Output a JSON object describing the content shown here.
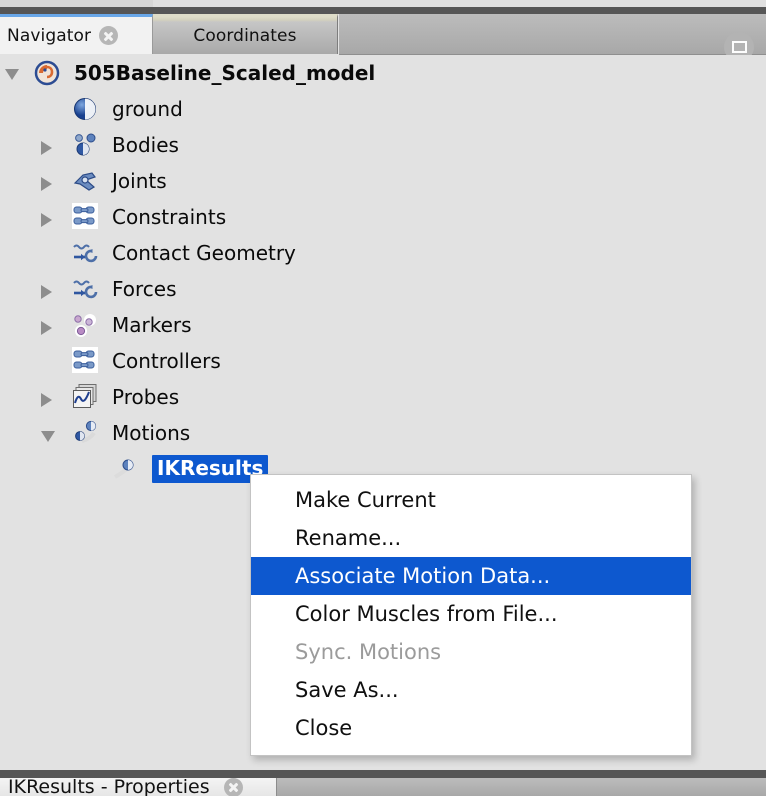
{
  "window": {
    "maximize_button": "restore-window-button"
  },
  "tabs": {
    "active": "Navigator",
    "items": [
      {
        "label": "Navigator",
        "active": true,
        "closable": true
      },
      {
        "label": "Coordinates",
        "active": false,
        "closable": false
      }
    ]
  },
  "tree": {
    "nodes": [
      {
        "label": "505Baseline_Scaled_model",
        "icon": "opensim-model-icon",
        "depth": 0,
        "expander": "open",
        "selected": false,
        "bold": true
      },
      {
        "label": "ground",
        "icon": "ground-body-icon",
        "depth": 1,
        "expander": "none",
        "selected": false,
        "bold": false
      },
      {
        "label": "Bodies",
        "icon": "bodies-icon",
        "depth": 1,
        "expander": "closed",
        "selected": false,
        "bold": false
      },
      {
        "label": "Joints",
        "icon": "joints-icon",
        "depth": 1,
        "expander": "closed",
        "selected": false,
        "bold": false
      },
      {
        "label": "Constraints",
        "icon": "constraints-chain-icon",
        "depth": 1,
        "expander": "closed",
        "selected": false,
        "bold": false
      },
      {
        "label": "Contact Geometry",
        "icon": "contact-geometry-icon",
        "depth": 1,
        "expander": "none",
        "selected": false,
        "bold": false
      },
      {
        "label": "Forces",
        "icon": "forces-icon",
        "depth": 1,
        "expander": "closed",
        "selected": false,
        "bold": false
      },
      {
        "label": "Markers",
        "icon": "markers-icon",
        "depth": 1,
        "expander": "closed",
        "selected": false,
        "bold": false
      },
      {
        "label": "Controllers",
        "icon": "controllers-chain-icon",
        "depth": 1,
        "expander": "none",
        "selected": false,
        "bold": false
      },
      {
        "label": "Probes",
        "icon": "probes-icon",
        "depth": 1,
        "expander": "closed",
        "selected": false,
        "bold": false
      },
      {
        "label": "Motions",
        "icon": "motions-icon",
        "depth": 1,
        "expander": "open",
        "selected": false,
        "bold": false
      },
      {
        "label": "IKResults",
        "icon": "motion-item-icon",
        "depth": 2,
        "expander": "none",
        "selected": true,
        "bold": true
      }
    ]
  },
  "context_menu": {
    "items": [
      {
        "label": "Make Current",
        "state": "normal"
      },
      {
        "label": "Rename...",
        "state": "normal"
      },
      {
        "label": "Associate Motion Data...",
        "state": "selected"
      },
      {
        "label": "Color Muscles from File...",
        "state": "normal"
      },
      {
        "label": "Sync. Motions",
        "state": "disabled"
      },
      {
        "label": "Save As...",
        "state": "normal"
      },
      {
        "label": "Close",
        "state": "normal"
      }
    ]
  },
  "bottom_bar": {
    "tab_label": "IKResults - Properties"
  },
  "colors": {
    "selection_blue": "#0d58cf",
    "panel_background": "#e2e2e2",
    "menu_background": "#ffffff",
    "disabled_text": "#9b9b9b",
    "active_tab_accent": "#69a7e8"
  }
}
